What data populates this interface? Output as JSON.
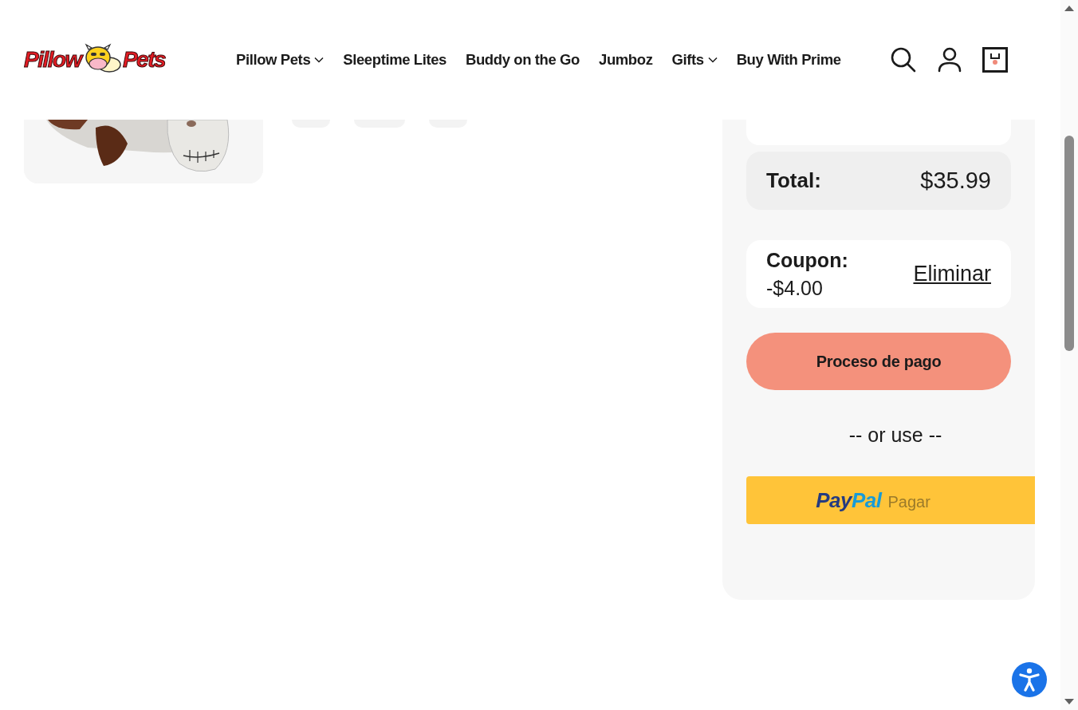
{
  "header": {
    "logo": {
      "word_1": "Pillow",
      "word_2": "Pets"
    },
    "nav": [
      {
        "label": "Pillow Pets",
        "has_menu": true
      },
      {
        "label": "Sleeptime Lites",
        "has_menu": false
      },
      {
        "label": "Buddy on the Go",
        "has_menu": false
      },
      {
        "label": "Jumboz",
        "has_menu": false
      },
      {
        "label": "Gifts",
        "has_menu": true
      },
      {
        "label": "Buy With Prime",
        "has_menu": false
      }
    ]
  },
  "summary": {
    "total": {
      "label": "Total:",
      "value": "$35.99"
    },
    "coupon": {
      "label": "Coupon:",
      "amount": "-$4.00",
      "remove": "Eliminar"
    },
    "checkout": "Proceso de pago",
    "divider": "-- or use --",
    "paypal": {
      "brand_1": "Pay",
      "brand_2": "Pal",
      "label": "Pagar"
    }
  }
}
